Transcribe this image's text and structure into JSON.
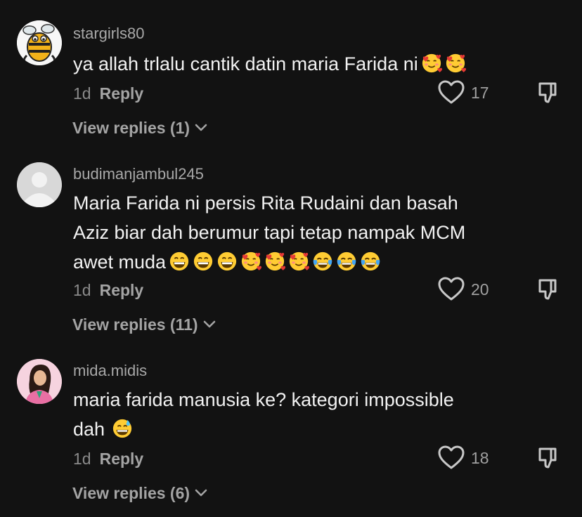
{
  "colors": {
    "background": "#121212",
    "username": "#a8a8a8",
    "text": "#f2f2f2",
    "muted": "#8a8a8a"
  },
  "comments": [
    {
      "username": "stargirls80",
      "text": "ya allah trlalu cantik datin maria Farida ni",
      "emojis": [
        "smiling-face-with-hearts",
        "smiling-face-with-hearts"
      ],
      "time": "1d",
      "reply_label": "Reply",
      "likes": "17",
      "view_replies": "View replies (1)",
      "avatar": "bee-cartoon-avatar"
    },
    {
      "username": "budimanjambul245",
      "text_lines": [
        "Maria Farida ni persis Rita Rudaini dan basah",
        "Aziz biar dah berumur tapi tetap nampak MCM",
        "awet muda"
      ],
      "emojis": [
        "grinning-face",
        "grinning-face",
        "grinning-face",
        "smiling-face-with-hearts",
        "smiling-face-with-hearts",
        "smiling-face-with-hearts",
        "tears-of-joy",
        "tears-of-joy",
        "tears-of-joy"
      ],
      "time": "1d",
      "reply_label": "Reply",
      "likes": "20",
      "view_replies": "View replies (11)",
      "avatar": "default-avatar"
    },
    {
      "username": "mida.midis",
      "text_lines": [
        "maria farida manusia ke? kategori impossible",
        "dah"
      ],
      "emojis": [
        "grinning-face-with-sweat"
      ],
      "time": "1d",
      "reply_label": "Reply",
      "likes": "18",
      "view_replies": "View replies (6)",
      "avatar": "woman-in-pink-avatar"
    }
  ]
}
